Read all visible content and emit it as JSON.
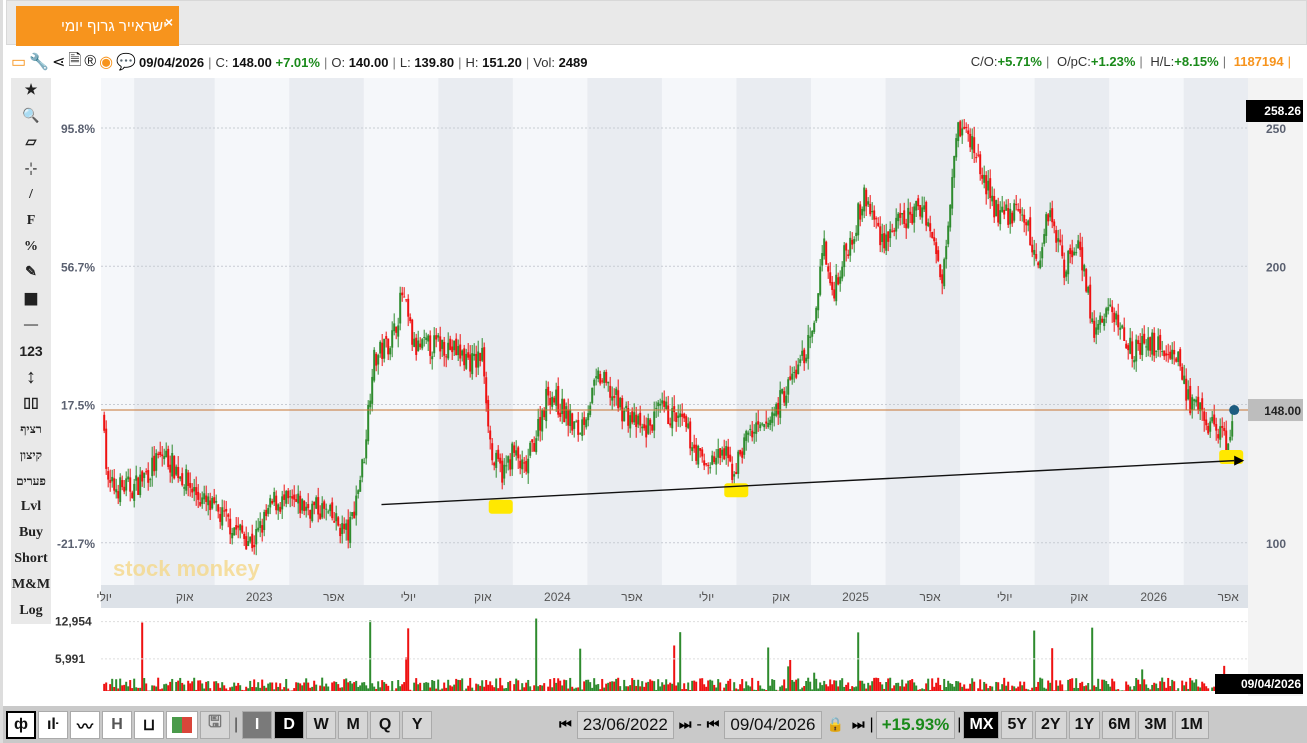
{
  "tab": {
    "title": "ישראייר גרוף יומי",
    "close": "×"
  },
  "info": {
    "date": "09/04/2026",
    "c_label": "C:",
    "close": "148.00",
    "change": "+7.01%",
    "o_label": "O:",
    "open": "140.00",
    "l_label": "L:",
    "low": "139.80",
    "h_label": "H:",
    "high": "151.20",
    "vol_label": "Vol:",
    "volume": "2489",
    "co_label": "C/O:",
    "co": "+5.71%",
    "opc_label": "O/pC:",
    "opc": "+1.23%",
    "hl_label": "H/L:",
    "hl": "+8.15%",
    "id": "1187194"
  },
  "sidebar": [
    "★",
    "🔍",
    "▱",
    "-¦-",
    "/",
    "F",
    "%",
    "✎",
    "■",
    "—",
    "123",
    "↕",
    "▯▯",
    "רציף",
    "קיצון",
    "פערים",
    "Lvl",
    "Buy",
    "Short",
    "M&M",
    "Log"
  ],
  "chart_data": {
    "type": "candlestick",
    "xlabel": "",
    "ylabel": "",
    "ylim": [
      82,
      262
    ],
    "y_ticks": [
      100,
      150,
      200,
      250
    ],
    "pct_ticks": [
      {
        "price": 250,
        "label": "95.8%"
      },
      {
        "price": 200,
        "label": "56.7%"
      },
      {
        "price": 150,
        "label": "17.5%"
      },
      {
        "price": 100,
        "label": "-21.7%"
      }
    ],
    "x_range": [
      2022.47,
      2026.3
    ],
    "x_ticks": [
      {
        "x": 2022.48,
        "label": "יולי"
      },
      {
        "x": 2022.75,
        "label": "אוק"
      },
      {
        "x": 2023.0,
        "label": "2023"
      },
      {
        "x": 2023.25,
        "label": "אפר"
      },
      {
        "x": 2023.5,
        "label": "יולי"
      },
      {
        "x": 2023.75,
        "label": "אוק"
      },
      {
        "x": 2024.0,
        "label": "2024"
      },
      {
        "x": 2024.25,
        "label": "אפר"
      },
      {
        "x": 2024.5,
        "label": "יולי"
      },
      {
        "x": 2024.75,
        "label": "אוק"
      },
      {
        "x": 2025.0,
        "label": "2025"
      },
      {
        "x": 2025.25,
        "label": "אפר"
      },
      {
        "x": 2025.5,
        "label": "יולי"
      },
      {
        "x": 2025.75,
        "label": "אוק"
      },
      {
        "x": 2026.0,
        "label": "2026"
      },
      {
        "x": 2026.25,
        "label": "אפר"
      }
    ],
    "close_series": [
      [
        2022.48,
        145
      ],
      [
        2022.49,
        120
      ],
      [
        2022.58,
        120
      ],
      [
        2022.68,
        132
      ],
      [
        2022.81,
        115
      ],
      [
        2022.98,
        100
      ],
      [
        2023.05,
        115
      ],
      [
        2023.21,
        112
      ],
      [
        2023.3,
        103
      ],
      [
        2023.35,
        130
      ],
      [
        2023.38,
        165
      ],
      [
        2023.45,
        175
      ],
      [
        2023.48,
        190
      ],
      [
        2023.52,
        170
      ],
      [
        2023.62,
        172
      ],
      [
        2023.72,
        165
      ],
      [
        2023.75,
        168
      ],
      [
        2023.78,
        130
      ],
      [
        2023.82,
        125
      ],
      [
        2023.85,
        133
      ],
      [
        2023.89,
        125
      ],
      [
        2023.97,
        155
      ],
      [
        2024.07,
        140
      ],
      [
        2024.14,
        160
      ],
      [
        2024.22,
        148
      ],
      [
        2024.29,
        140
      ],
      [
        2024.35,
        148
      ],
      [
        2024.42,
        143
      ],
      [
        2024.49,
        128
      ],
      [
        2024.56,
        132
      ],
      [
        2024.59,
        125
      ],
      [
        2024.64,
        140
      ],
      [
        2024.69,
        140
      ],
      [
        2024.79,
        160
      ],
      [
        2024.86,
        175
      ],
      [
        2024.89,
        210
      ],
      [
        2024.92,
        190
      ],
      [
        2025.03,
        225
      ],
      [
        2025.09,
        210
      ],
      [
        2025.23,
        222
      ],
      [
        2025.29,
        195
      ],
      [
        2025.34,
        252
      ],
      [
        2025.39,
        245
      ],
      [
        2025.46,
        222
      ],
      [
        2025.49,
        218
      ],
      [
        2025.56,
        220
      ],
      [
        2025.61,
        200
      ],
      [
        2025.65,
        222
      ],
      [
        2025.7,
        200
      ],
      [
        2025.75,
        210
      ],
      [
        2025.8,
        175
      ],
      [
        2025.85,
        185
      ],
      [
        2025.93,
        170
      ],
      [
        2026.0,
        172
      ],
      [
        2026.08,
        168
      ],
      [
        2026.12,
        150
      ],
      [
        2026.17,
        145
      ],
      [
        2026.22,
        140
      ],
      [
        2026.25,
        135
      ],
      [
        2026.27,
        148
      ]
    ],
    "max_label": "258.26",
    "last_label": "148.00",
    "hline": 148,
    "trendline": [
      [
        2023.41,
        113.8
      ],
      [
        2026.27,
        129.7
      ]
    ],
    "highlights": [
      [
        2023.81,
        113
      ],
      [
        2024.6,
        119
      ],
      [
        2026.26,
        131
      ]
    ],
    "volume_ticks": [
      {
        "v": 12954,
        "label": "12,954"
      },
      {
        "v": 5991,
        "label": "5,991"
      }
    ],
    "last_date_label": "09/04/2026",
    "watermark": "stock monkey"
  },
  "bottom": {
    "intervals": [
      "I",
      "D",
      "W",
      "M",
      "Q",
      "Y"
    ],
    "start_date": "23/06/2022",
    "dash": "-",
    "end_date": "09/04/2026",
    "change": "+15.93%",
    "ranges": [
      "MX",
      "5Y",
      "2Y",
      "1Y",
      "6M",
      "3M",
      "1M"
    ]
  }
}
